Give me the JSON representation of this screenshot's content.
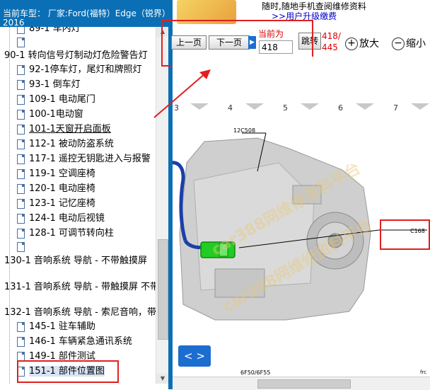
{
  "header": {
    "title": "当前车型： 厂家:Ford(福特）Edge（锐界）2015-",
    "title_cont": "2016"
  },
  "ad": {
    "line1": "随时,随地手机查阅维修资料",
    "line2": ">>用户升级缴费"
  },
  "tree": {
    "items": [
      {
        "label": "89-1 车内灯",
        "type": "doc"
      },
      {
        "label": "",
        "type": "doc"
      },
      {
        "label": "90-1 转向信号灯制动灯危险警告灯",
        "type": "folder"
      },
      {
        "label": "92-1停车灯，尾灯和牌照灯",
        "type": "doc"
      },
      {
        "label": "93-1 倒车灯",
        "type": "doc"
      },
      {
        "label": "109-1 电动尾门",
        "type": "doc"
      },
      {
        "label": "100-1电动窗",
        "type": "doc"
      },
      {
        "label": "101-1天窗开启面板",
        "type": "doc"
      },
      {
        "label": "112-1 被动防盗系统",
        "type": "doc"
      },
      {
        "label": "117-1 遥控无钥匙进入与报警",
        "type": "doc"
      },
      {
        "label": "119-1 空调座椅",
        "type": "doc"
      },
      {
        "label": "120-1 电动座椅",
        "type": "doc"
      },
      {
        "label": "123-1 记忆座椅",
        "type": "doc"
      },
      {
        "label": "124-1 电动后视镜",
        "type": "doc"
      },
      {
        "label": "128-1 可调节转向柱",
        "type": "doc"
      },
      {
        "label": "",
        "type": "doc"
      },
      {
        "label": "130-1 音响系统 导航 - 不带触摸屏",
        "type": "folder"
      },
      {
        "label": "131-1 音响系统 导航 - 带触摸屏 不带",
        "type": "folder"
      },
      {
        "label": "132-1 音响系统 导航 - 索尼音响，带",
        "type": "folder"
      },
      {
        "label": "145-1 驻车辅助",
        "type": "doc"
      },
      {
        "label": "146-1 车辆紧急通讯系统",
        "type": "doc"
      },
      {
        "label": "149-1 部件测试",
        "type": "doc"
      },
      {
        "label": "151-1 部件位置图",
        "type": "doc"
      }
    ]
  },
  "toolbar": {
    "prev_label": "上一页",
    "next_label": "下一页",
    "current_label": "当前为",
    "page_value": "418",
    "jump_label": "跳转",
    "page_fraction_num": "418/",
    "page_fraction_den": "445",
    "zoom_in_label": "放大",
    "zoom_out_label": "缩小"
  },
  "viewer": {
    "grid_numbers": [
      "3",
      "4",
      "5",
      "6",
      "7"
    ],
    "callout_1": "12C508",
    "callout_2": "C168",
    "footer_code": "6F50/6F55",
    "footer_right": "frc",
    "nav_label": "< >",
    "watermark": "car388网维修资料平台"
  },
  "colors": {
    "header_bg": "#0b6fb5",
    "annotation_red": "#e02020",
    "nav_blue": "#1c6dd0",
    "connector_green": "#22cc22"
  }
}
